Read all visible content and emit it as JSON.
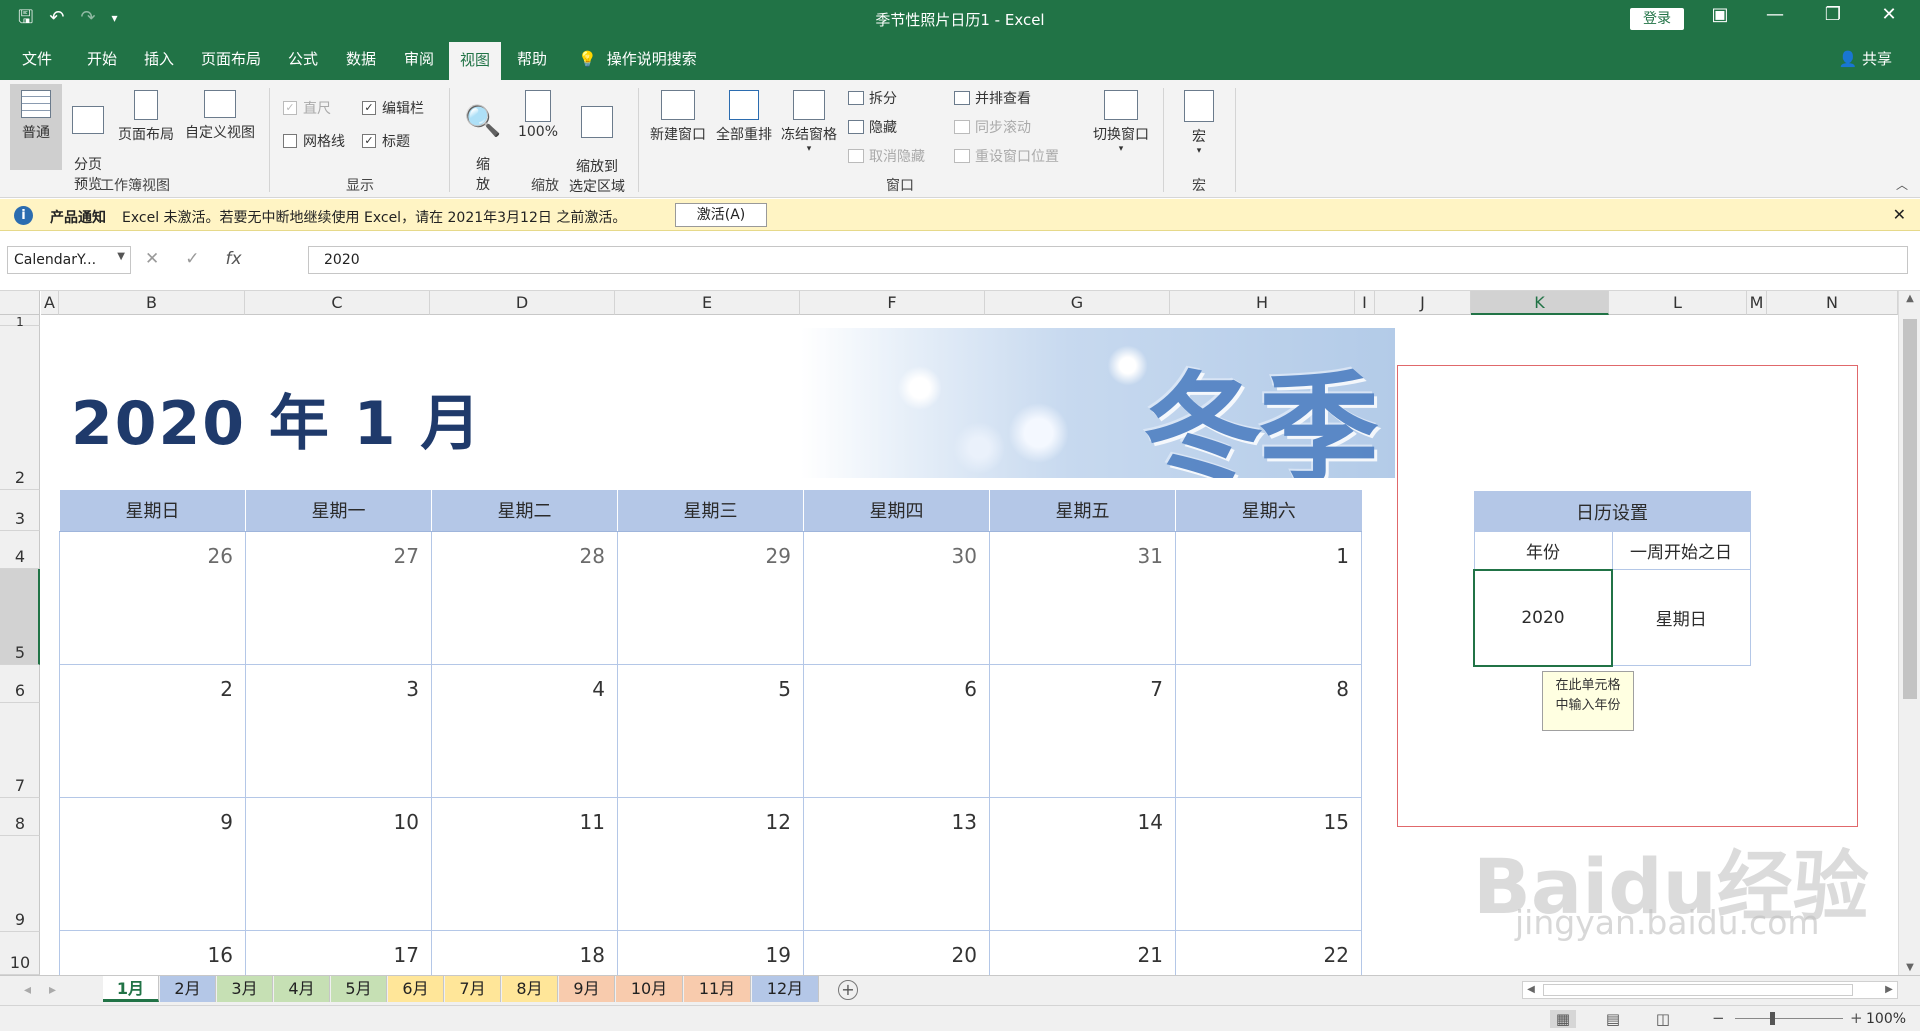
{
  "window": {
    "title": "季节性照片日历1  -  Excel",
    "login_label": "登录",
    "qat": [
      "save-icon",
      "undo-icon",
      "redo-icon",
      "customize-icon"
    ]
  },
  "tabs": [
    "文件",
    "开始",
    "插入",
    "页面布局",
    "公式",
    "数据",
    "审阅",
    "视图",
    "帮助",
    "操作说明搜索"
  ],
  "active_tab": "视图",
  "share_label": "共享",
  "ribbon": {
    "workbook_views": {
      "normal": "普通",
      "page_break": "分页\n预览",
      "page_layout": "页面布局",
      "custom": "自定义视图",
      "group": "工作簿视图"
    },
    "show": {
      "ruler": "直尺",
      "formula_bar": "编辑栏",
      "gridlines": "网格线",
      "headings": "标题",
      "group": "显示"
    },
    "zoom": {
      "zoom": "缩\n放",
      "zoom100": "100%",
      "zoom_sel": "缩放到\n选定区域",
      "group": "缩放"
    },
    "window": {
      "new_window": "新建窗口",
      "arrange_all": "全部重排",
      "freeze": "冻结窗格",
      "split": "拆分",
      "hide": "隐藏",
      "unhide": "取消隐藏",
      "side_by_side": "并排查看",
      "sync_scroll": "同步滚动",
      "reset_pos": "重设窗口位置",
      "switch": "切换窗口",
      "group": "窗口"
    },
    "macros": {
      "macros": "宏",
      "group": "宏"
    }
  },
  "notice": {
    "title": "产品通知",
    "text": "Excel 未激活。若要无中断地继续使用 Excel，请在 2021年3月12日 之前激活。",
    "button": "激活(A)"
  },
  "formula_bar": {
    "name_box": "CalendarY...",
    "fx": "fx",
    "value": "2020"
  },
  "columns": [
    "A",
    "B",
    "C",
    "D",
    "E",
    "F",
    "G",
    "H",
    "I",
    "J",
    "K",
    "L",
    "M",
    "N"
  ],
  "selected_column": "K",
  "rows": [
    "1",
    "2",
    "3",
    "4",
    "5",
    "6",
    "7",
    "8",
    "9",
    "10"
  ],
  "calendar": {
    "title": "2020 年 1 月",
    "banner_text": "冬季",
    "weekdays": [
      "星期日",
      "星期一",
      "星期二",
      "星期三",
      "星期四",
      "星期五",
      "星期六"
    ],
    "weeks": [
      [
        "26",
        "27",
        "28",
        "29",
        "30",
        "31",
        "1"
      ],
      [
        "2",
        "3",
        "4",
        "5",
        "6",
        "7",
        "8"
      ],
      [
        "9",
        "10",
        "11",
        "12",
        "13",
        "14",
        "15"
      ],
      [
        "16",
        "17",
        "18",
        "19",
        "20",
        "21",
        "22"
      ]
    ]
  },
  "settings": {
    "title": "日历设置",
    "year_label": "年份",
    "weekstart_label": "一周开始之日",
    "year_value": "2020",
    "weekstart_value": "星期日",
    "tooltip": "在此单元格\n中输入年份"
  },
  "sheet_tabs": [
    {
      "label": "1月",
      "color": "#ffffff"
    },
    {
      "label": "2月",
      "color": "#b4c7e7"
    },
    {
      "label": "3月",
      "color": "#c6e0b4"
    },
    {
      "label": "4月",
      "color": "#c6e0b4"
    },
    {
      "label": "5月",
      "color": "#c6e0b4"
    },
    {
      "label": "6月",
      "color": "#ffe699"
    },
    {
      "label": "7月",
      "color": "#ffe699"
    },
    {
      "label": "8月",
      "color": "#ffe699"
    },
    {
      "label": "9月",
      "color": "#f8cbad"
    },
    {
      "label": "10月",
      "color": "#f8cbad"
    },
    {
      "label": "11月",
      "color": "#f8cbad"
    },
    {
      "label": "12月",
      "color": "#b4c7e7"
    }
  ],
  "watermark": {
    "brand": "Baidu经验",
    "url": "jingyan.baidu.com"
  },
  "status": {
    "zoom": "100%"
  },
  "colors": {
    "excel_green": "#217346",
    "header_blue": "#b4c7e7",
    "title_navy": "#1f3a6b",
    "panel_border": "#e0686b"
  }
}
